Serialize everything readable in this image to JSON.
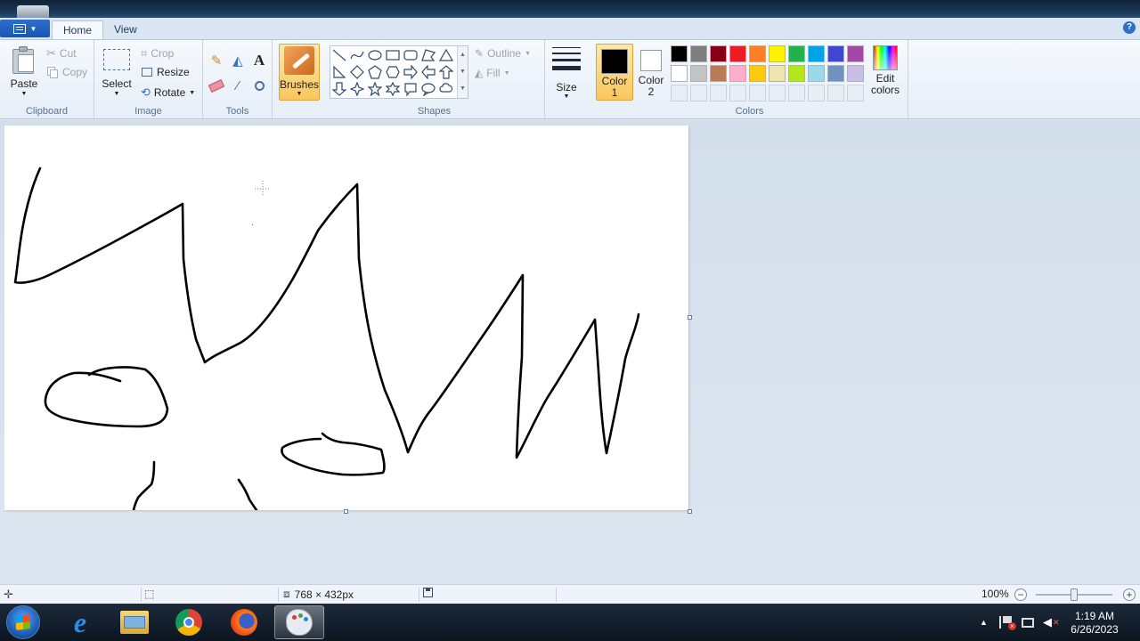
{
  "tabs": {
    "home": "Home",
    "view": "View"
  },
  "clipboard": {
    "paste": "Paste",
    "cut": "Cut",
    "copy": "Copy",
    "group": "Clipboard"
  },
  "image": {
    "select": "Select",
    "crop": "Crop",
    "resize": "Resize",
    "rotate": "Rotate",
    "group": "Image"
  },
  "tools": {
    "group": "Tools",
    "text_tool": "A"
  },
  "brushes": {
    "label": "Brushes"
  },
  "shapes": {
    "outline": "Outline",
    "fill": "Fill",
    "group": "Shapes"
  },
  "size": {
    "label": "Size"
  },
  "colors": {
    "color1_label": "Color",
    "color1_num": "1",
    "color2_label": "Color",
    "color2_num": "2",
    "color1": "#000000",
    "color2": "#ffffff",
    "edit_label": "Edit",
    "edit_label2": "colors",
    "group": "Colors",
    "palette_row1": [
      "#000000",
      "#7f7f7f",
      "#880015",
      "#ed1c24",
      "#ff7f27",
      "#fff200",
      "#22b14c",
      "#00a2e8",
      "#3f48cc",
      "#a349a4"
    ],
    "palette_row2": [
      "#ffffff",
      "#c3c3c3",
      "#b97a57",
      "#ffaec9",
      "#ffc90e",
      "#efe4b0",
      "#b5e61d",
      "#99d9ea",
      "#7092be",
      "#c8bfe7"
    ]
  },
  "status": {
    "canvas_size": "768 × 432px",
    "zoom": "100%"
  },
  "taskbar": {
    "time": "1:19 AM",
    "date": "6/26/2023"
  }
}
